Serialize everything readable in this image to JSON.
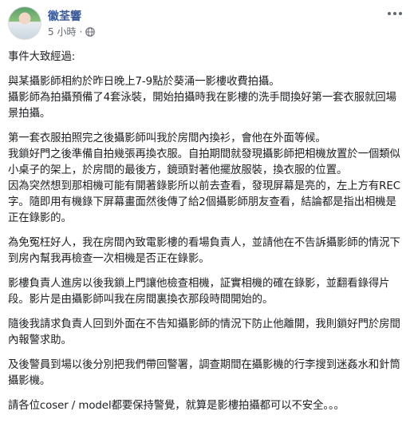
{
  "post": {
    "author": "徽荃響",
    "timestamp": "5 小時",
    "separator": "·",
    "privacy_icon": "globe-icon",
    "paragraphs": [
      "事件大致經過:",
      "與某攝影師相約於昨日晚上7-9點於葵涌一影樓收費拍攝。\n攝影師為拍攝預備了4套泳裝，開始拍攝時我在影樓的洗手間換好第一套衣服就回場景拍攝。",
      "第一套衣服拍照完之後攝影師叫我於房間內換衫，會他在外面等候。\n我鎖好門之後準備自拍幾張再換衣服。自拍期間就發現攝影師把相機放置於一個類似小桌子的架上，於房間的最後方，鏡頭對著他擺放服裝，換衣服的位置。\n因為突然想到那相機可能有開著錄影所以前去查看，發現屏幕是亮的，左上方有REC字。隨即用有機錄下屏幕畫面然後傳了給2個攝影師朋友查看，結論都是指出相機是正在錄影的。",
      "為免冤枉好人，我在房間內致電影樓的看場負責人，並請他在不告訴攝影師的情況下到房內幫我再檢查一次相機是否正在錄影。",
      "影樓負責人進房以後我鎖上門讓他檢查相機，証實相機的確在錄影，並翻看錄得片段。影片是由攝影師叫我在房間裏換衣那段時間開始的。",
      "隨後我請求負責人回到外面在不告知攝影師的情況下防止他離開，我則鎖好門於房間內報警求助。",
      "及後警員到場以後分別把我們帶回警署，調查期間在攝影機的行李搜到迷姦水和針筒攝影機。",
      "請各位coser / model都要保持警覺，就算是影樓拍攝都可以不安全。。。"
    ]
  }
}
